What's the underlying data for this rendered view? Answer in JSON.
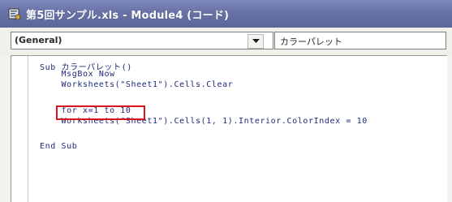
{
  "window": {
    "title": "第5回サンプル.xls - Module4 (コード)"
  },
  "toolbar": {
    "object_combo_value": "(General)",
    "procedure_combo_value": "カラーパレット"
  },
  "code": {
    "lines": [
      "Sub カラーパレット()",
      "    MsgBox Now",
      "    Worksheets(\"Sheet1\").Cells.Clear",
      "",
      "    for x=1 to 10",
      "    Worksheets(\"Sheet1\").Cells(1, 1).Interior.ColorIndex = 10",
      "",
      "End Sub"
    ],
    "highlighted_text": "for x=1 to 10"
  },
  "colors": {
    "titlebar": "#6872a8",
    "code_text": "#1e2a7a",
    "highlight_border": "#d8141c"
  },
  "icons": {
    "title_icon": "vba-module-icon",
    "dropdown": "chevron-down-icon"
  }
}
